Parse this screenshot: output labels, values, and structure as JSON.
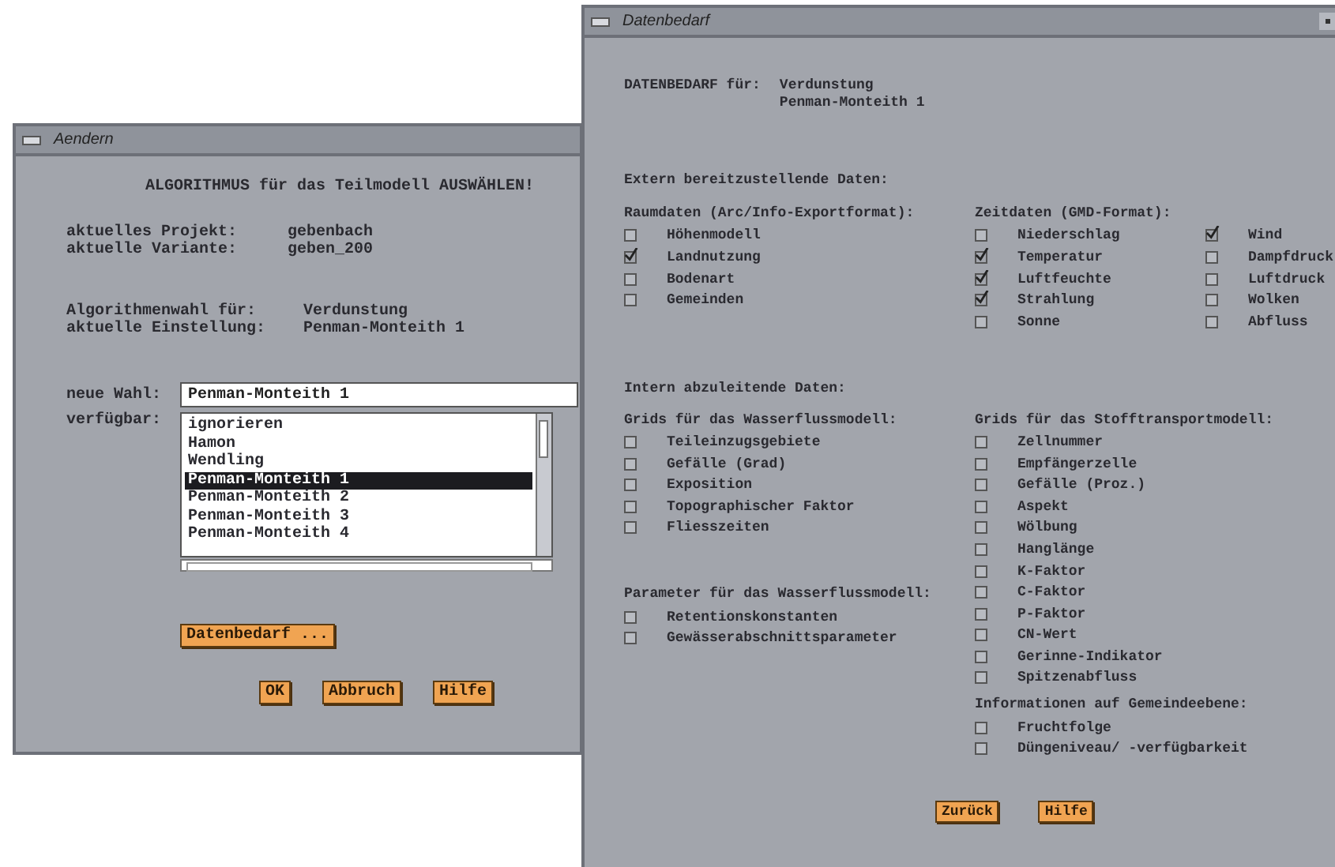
{
  "aendern_window": {
    "title": "Aendern",
    "heading": "ALGORITHMUS für das Teilmodell AUSWÄHLEN!",
    "project_info": [
      {
        "label": "aktuelles Projekt:",
        "value": "gebenbach"
      },
      {
        "label": "aktuelle Variante:",
        "value": "geben_200"
      }
    ],
    "algorithm_info": [
      {
        "label": "Algorithmenwahl für:",
        "value": "Verdunstung"
      },
      {
        "label": "aktuelle Einstellung:",
        "value": "Penman-Monteith 1"
      }
    ],
    "new_choice": {
      "label": "neue Wahl:",
      "value": "Penman-Monteith 1"
    },
    "available": {
      "label": "verfügbar:",
      "items": [
        {
          "text": "ignorieren",
          "selected": false
        },
        {
          "text": "Hamon",
          "selected": false
        },
        {
          "text": "Wendling",
          "selected": false
        },
        {
          "text": "Penman-Monteith 1",
          "selected": true
        },
        {
          "text": "Penman-Monteith 2",
          "selected": false
        },
        {
          "text": "Penman-Monteith 3",
          "selected": false
        },
        {
          "text": "Penman-Monteith 4",
          "selected": false
        }
      ]
    },
    "data_button": "Datenbedarf ...",
    "buttons": [
      "OK",
      "Abbruch",
      "Hilfe"
    ]
  },
  "datenbedarf_window": {
    "title": "Datenbedarf",
    "requirement_label": "DATENBEDARF für:",
    "requirement_values": [
      "Verdunstung",
      "Penman-Monteith 1"
    ],
    "external_heading": "Extern bereitzustellende Daten:",
    "external_groups": [
      {
        "heading": "Raumdaten (Arc/Info-Exportformat):",
        "items": [
          {
            "label": "Höhenmodell",
            "checked": false
          },
          {
            "label": "Landnutzung",
            "checked": true
          },
          {
            "label": "Bodenart",
            "checked": false
          },
          {
            "label": "Gemeinden",
            "checked": false
          }
        ]
      },
      {
        "heading": "Zeitdaten (GMD-Format):",
        "items": [
          {
            "label": "Niederschlag",
            "checked": false
          },
          {
            "label": "Temperatur",
            "checked": true
          },
          {
            "label": "Luftfeuchte",
            "checked": true
          },
          {
            "label": "Strahlung",
            "checked": true
          },
          {
            "label": "Sonne",
            "checked": false
          },
          {
            "label": "Wind",
            "checked": true
          },
          {
            "label": "Dampfdruck",
            "checked": false
          },
          {
            "label": "Luftdruck",
            "checked": false
          },
          {
            "label": "Wolken",
            "checked": false
          },
          {
            "label": "Abfluss",
            "checked": false
          }
        ]
      }
    ],
    "internal_heading": "Intern abzuleitende Daten:",
    "internal_left": [
      {
        "heading": "Grids für das Wasserflussmodell:",
        "items": [
          {
            "label": "Teileinzugsgebiete",
            "checked": false
          },
          {
            "label": "Gefälle (Grad)",
            "checked": false
          },
          {
            "label": "Exposition",
            "checked": false
          },
          {
            "label": "Topographischer Faktor",
            "checked": false
          },
          {
            "label": "Fliesszeiten",
            "checked": false
          }
        ]
      },
      {
        "heading": "Parameter für das Wasserflussmodell:",
        "items": [
          {
            "label": "Retentionskonstanten",
            "checked": false
          },
          {
            "label": "Gewässerabschnittsparameter",
            "checked": false
          }
        ]
      }
    ],
    "internal_right": [
      {
        "heading": "Grids für das Stofftransportmodell:",
        "items": [
          {
            "label": "Zellnummer",
            "checked": false
          },
          {
            "label": "Empfängerzelle",
            "checked": false
          },
          {
            "label": "Gefälle (Proz.)",
            "checked": false
          },
          {
            "label": "Aspekt",
            "checked": false
          },
          {
            "label": "Wölbung",
            "checked": false
          },
          {
            "label": "Hanglänge",
            "checked": false
          },
          {
            "label": "K-Faktor",
            "checked": false
          },
          {
            "label": "C-Faktor",
            "checked": false
          },
          {
            "label": "P-Faktor",
            "checked": false
          },
          {
            "label": "CN-Wert",
            "checked": false
          },
          {
            "label": "Gerinne-Indikator",
            "checked": false
          },
          {
            "label": "Spitzenabfluss",
            "checked": false
          }
        ]
      },
      {
        "heading": "Informationen auf Gemeindeebene:",
        "items": [
          {
            "label": "Fruchtfolge",
            "checked": false
          },
          {
            "label": "Düngeniveau/ -verfügbarkeit",
            "checked": false
          }
        ]
      }
    ],
    "buttons": [
      "Zurück",
      "Hilfe"
    ]
  }
}
